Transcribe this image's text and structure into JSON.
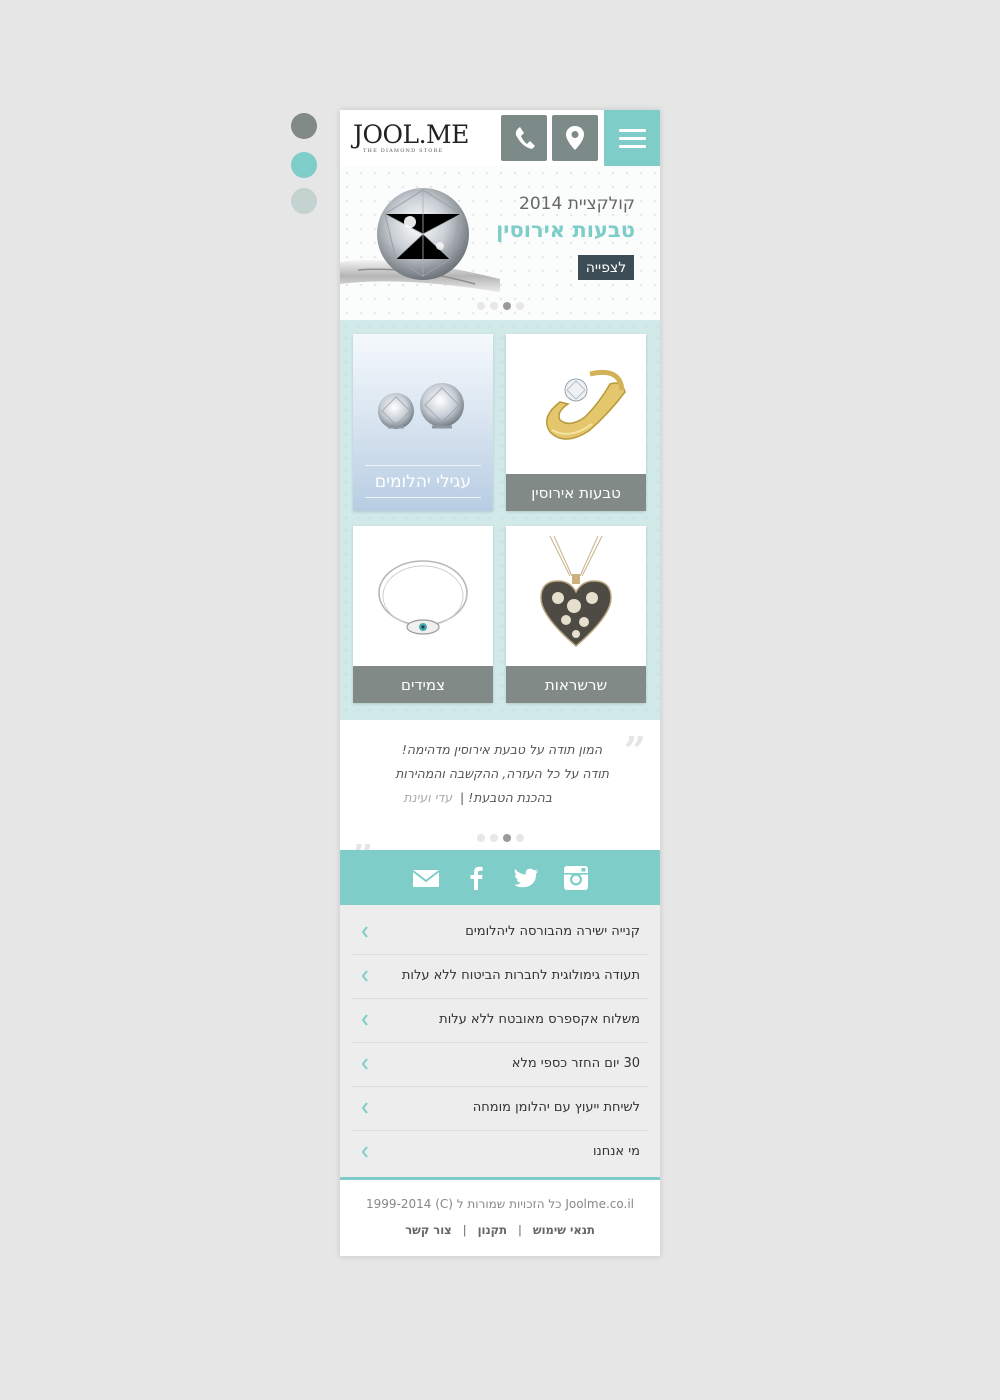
{
  "palette": {
    "swatches": [
      "#828a88",
      "#7ecdc9",
      "#c4d3cf"
    ],
    "accent": "#7ecdc9",
    "dark_button": "#3d4d55",
    "label_gray": "#828a88"
  },
  "header": {
    "logo_text": "JOOL.ME",
    "logo_tagline": "THE DIAMOND STORE",
    "icons": [
      "phone-icon",
      "location-pin-icon",
      "hamburger-menu-icon"
    ]
  },
  "banner": {
    "line1": "קולקציית 2014",
    "line2": "טבעות אירוסין",
    "button_label": "לצפייה",
    "slides_total": 4,
    "slide_active": 3
  },
  "categories": [
    {
      "label": "טבעות אירוסין",
      "image": "engagement-ring"
    },
    {
      "label": "עגילי יהלומים",
      "image": "diamond-earrings"
    },
    {
      "label": "שרשראות",
      "image": "heart-pendant"
    },
    {
      "label": "צמידים",
      "image": "evil-eye-bracelet"
    }
  ],
  "testimonial": {
    "line1": "המון תודה על טבעת אירוסין מדהימה!",
    "line2": "תודה על כל העזרה, ההקשבה והמהירות",
    "line3": "בהכנת הטבעת!",
    "separator": "|",
    "author": "עדי ועינת",
    "slides_total": 4,
    "slide_active": 3
  },
  "social": [
    "instagram-icon",
    "twitter-icon",
    "facebook-icon",
    "email-icon"
  ],
  "list_items": [
    "קנייה ישירה מהבורסה ליהלומים",
    "תעודה גימולוגית לחברות הביטוח ללא עלות",
    "משלוח אקספרס מאובטח ללא עלות",
    "30 יום החזר כספי מלא",
    "לשיחת ייעוץ עם יהלומן מומחה",
    "מי אנחנו"
  ],
  "footer": {
    "copyright": "1999-2014 (C) כל הזכויות שמורות ל Joolme.co.il",
    "links": [
      "תנאי שימוש",
      "תקנון",
      "צור קשר"
    ],
    "link_separator": "|"
  }
}
